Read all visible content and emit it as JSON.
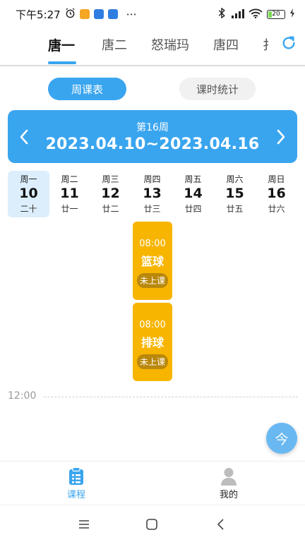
{
  "status_bar": {
    "time": "下午5:27",
    "more": "⋯",
    "battery": "20",
    "app_icons": [
      "#f5a623",
      "#2f7de1",
      "#2f7de1"
    ]
  },
  "tabs": {
    "items": [
      "唐一",
      "唐二",
      "怒瑞玛",
      "唐四",
      "扌"
    ],
    "active_index": 0
  },
  "toggle": {
    "week_label": "周课表",
    "stats_label": "课时统计"
  },
  "week": {
    "number_label": "第16周",
    "range": "2023.04.10~2023.04.16"
  },
  "days": [
    {
      "weekday": "周一",
      "date": "10",
      "lunar": "二十",
      "selected": true
    },
    {
      "weekday": "周二",
      "date": "11",
      "lunar": "廿一",
      "selected": false
    },
    {
      "weekday": "周三",
      "date": "12",
      "lunar": "廿二",
      "selected": false
    },
    {
      "weekday": "周四",
      "date": "13",
      "lunar": "廿三",
      "selected": false
    },
    {
      "weekday": "周五",
      "date": "14",
      "lunar": "廿四",
      "selected": false
    },
    {
      "weekday": "周六",
      "date": "15",
      "lunar": "廿五",
      "selected": false
    },
    {
      "weekday": "周日",
      "date": "16",
      "lunar": "廿六",
      "selected": false
    }
  ],
  "courses": [
    {
      "time": "08:00",
      "name": "篮球",
      "status": "未上课"
    },
    {
      "time": "08:00",
      "name": "排球",
      "status": "未上课"
    }
  ],
  "timeline": {
    "label": "12:00"
  },
  "fab": {
    "today_label": "今"
  },
  "bottom_nav": {
    "courses_label": "课程",
    "mine_label": "我的"
  },
  "colors": {
    "accent": "#3aa5ef",
    "course_card": "#f7b500"
  }
}
